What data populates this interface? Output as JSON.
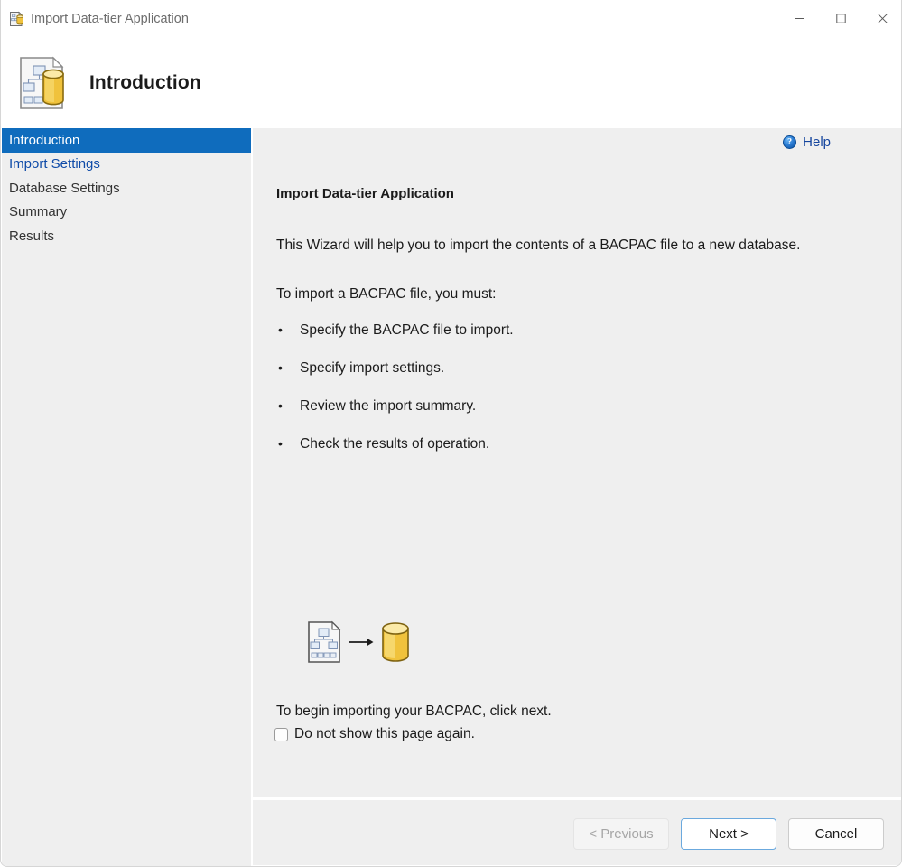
{
  "window": {
    "title": "Import Data-tier Application",
    "icon": "dacpac-icon",
    "controls": [
      {
        "name": "minimize-button",
        "glyph": "minimize"
      },
      {
        "name": "maximize-button",
        "glyph": "maximize"
      },
      {
        "name": "close-button",
        "glyph": "close"
      }
    ]
  },
  "header": {
    "title": "Introduction",
    "icon": "dacpac-icon"
  },
  "sidebar": {
    "items": [
      {
        "label": "Introduction",
        "state": "selected"
      },
      {
        "label": "Import Settings",
        "state": "link"
      },
      {
        "label": "Database Settings",
        "state": "normal"
      },
      {
        "label": "Summary",
        "state": "normal"
      },
      {
        "label": "Results",
        "state": "normal"
      }
    ]
  },
  "content": {
    "help_label": "Help",
    "help_icon": "help-question-icon",
    "heading": "Import Data-tier Application",
    "paragraph_1": "This Wizard will help you to import the contents of a BACPAC file to a new database.",
    "paragraph_2": "To import a BACPAC file, you must:",
    "bullet_marker": "•",
    "bullets": [
      "Specify the BACPAC file to import.",
      "Specify import settings.",
      "Review the import summary.",
      "Check the results of operation."
    ],
    "illustration": {
      "source_icon": "bacpac-file-icon",
      "arrow_icon": "arrow-right-icon",
      "target_icon": "database-icon"
    },
    "begin_text": "To begin importing your BACPAC, click next.",
    "checkbox_label": "Do not show this page again.",
    "checkbox_checked": false
  },
  "footer": {
    "previous_label": "< Previous",
    "next_label": "Next >",
    "cancel_label": "Cancel"
  },
  "colors": {
    "selection_blue": "#0f6cbd",
    "link_blue": "#0f4ba8",
    "panel_gray": "#efefef",
    "focus_border": "#6ba9de",
    "database_gold": "#f2c94c"
  }
}
